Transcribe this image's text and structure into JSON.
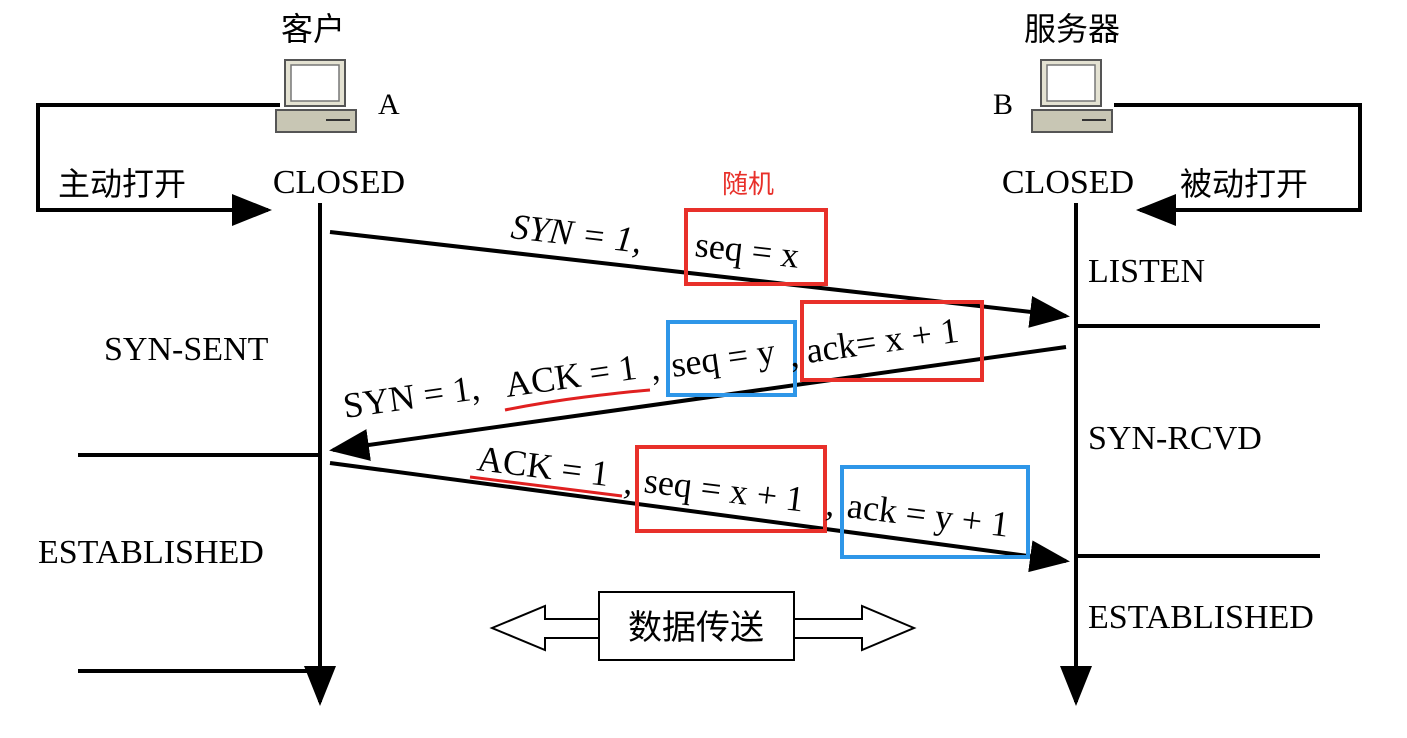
{
  "client": {
    "title": "客户",
    "host_label": "A",
    "initial_state": "CLOSED",
    "open_mode": "主动打开",
    "states": [
      "SYN-SENT",
      "ESTABLISHED"
    ]
  },
  "server": {
    "title": "服务器",
    "host_label": "B",
    "initial_state": "CLOSED",
    "open_mode": "被动打开",
    "states": [
      "LISTEN",
      "SYN-RCVD",
      "ESTABLISHED"
    ]
  },
  "segments": [
    {
      "parts": [
        "SYN = 1,",
        "seq = x"
      ],
      "annotation": "随机"
    },
    {
      "parts": [
        "SYN = 1,",
        "ACK = 1",
        ",",
        "seq = y",
        ",",
        "ack= x + 1"
      ]
    },
    {
      "parts": [
        "ACK = 1",
        ",",
        "seq = x + 1",
        ",",
        "ack = y + 1"
      ]
    }
  ],
  "data_transfer": "数据传送",
  "colors": {
    "line": "#000000",
    "red_box": "#e8302a",
    "blue_box": "#2e96e8",
    "underline": "#e02020",
    "computer": "#c8c6b4"
  }
}
